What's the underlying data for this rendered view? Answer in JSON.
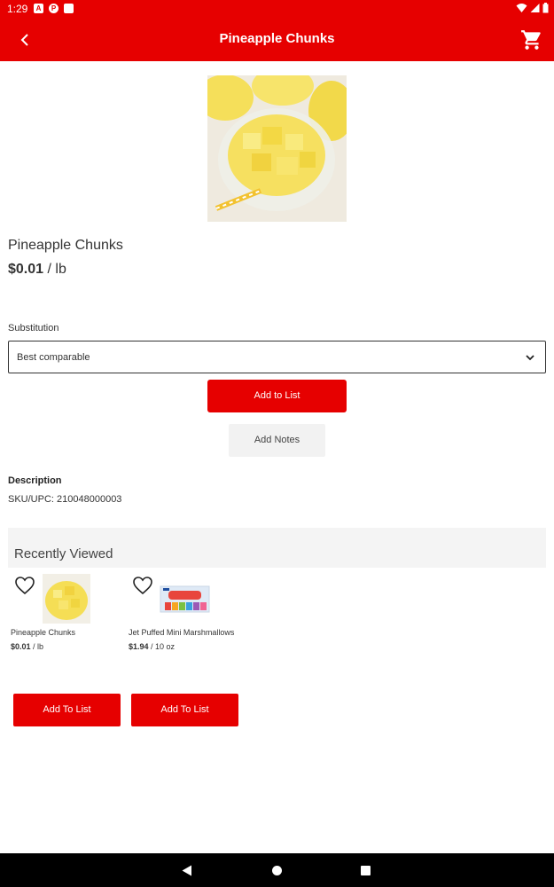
{
  "status_bar": {
    "time": "1:29",
    "icons_left": [
      "a-icon",
      "notification-icon",
      "sd-card-icon"
    ],
    "icons_right": [
      "wifi-icon",
      "signal-icon",
      "battery-icon"
    ]
  },
  "app_bar": {
    "title": "Pineapple Chunks",
    "back_icon": "arrow-back-icon",
    "cart_icon": "shopping-cart-icon"
  },
  "product": {
    "name": "Pineapple Chunks",
    "price": "$0.01",
    "unit": " / lb",
    "image": "pineapple-chunks-in-glass-bowl"
  },
  "substitution": {
    "label": "Substitution",
    "selected": "Best comparable"
  },
  "buttons": {
    "add_to_list": "Add to List",
    "add_notes": "Add Notes"
  },
  "description": {
    "heading": "Description",
    "sku": "SKU/UPC: 210048000003"
  },
  "recently_viewed": {
    "title": "Recently Viewed",
    "items": [
      {
        "name": "Pineapple Chunks",
        "price": "$0.01",
        "unit": " / lb",
        "add_label": "Add To List"
      },
      {
        "name": "Jet Puffed Mini Marshmallows",
        "price": "$1.94",
        "unit": " / 10 oz",
        "add_label": "Add To List"
      }
    ]
  },
  "colors": {
    "brand_red": "#e60000",
    "nav_black": "#000000",
    "section_gray": "#f4f4f4"
  }
}
